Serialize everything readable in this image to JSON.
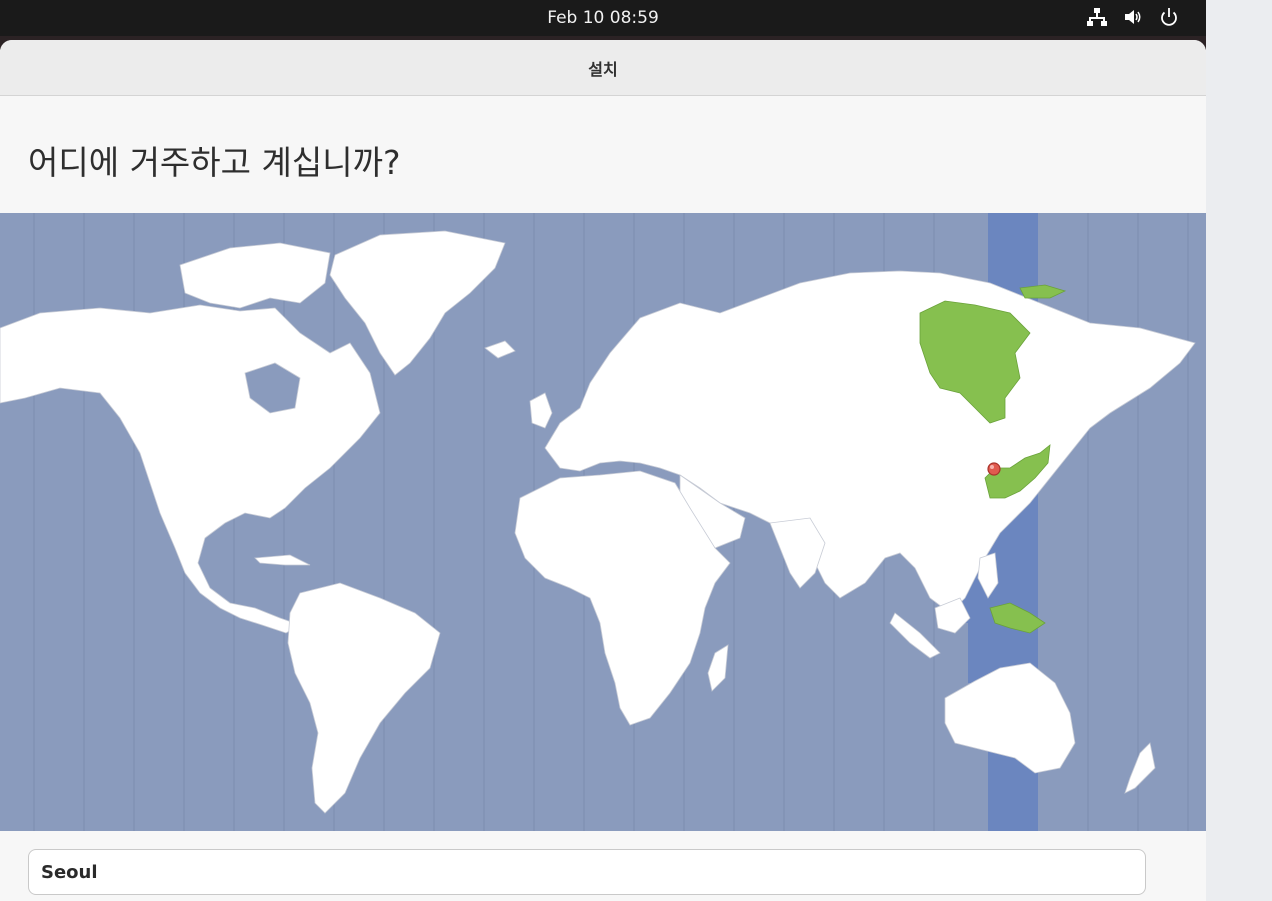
{
  "topbar": {
    "clock": "Feb 10  08:59",
    "icons": [
      "network-icon",
      "volume-icon",
      "power-icon"
    ]
  },
  "window": {
    "title": "설치"
  },
  "page": {
    "heading": "어디에 거주하고 계십니까?"
  },
  "timezone": {
    "selected_city": "Seoul",
    "colors": {
      "ocean": "#8a9bbd",
      "land": "#ffffff",
      "selected_zone_band": "#6b86bf",
      "selected_zone_land": "#86c04f",
      "marker": "#e05a4f"
    }
  }
}
